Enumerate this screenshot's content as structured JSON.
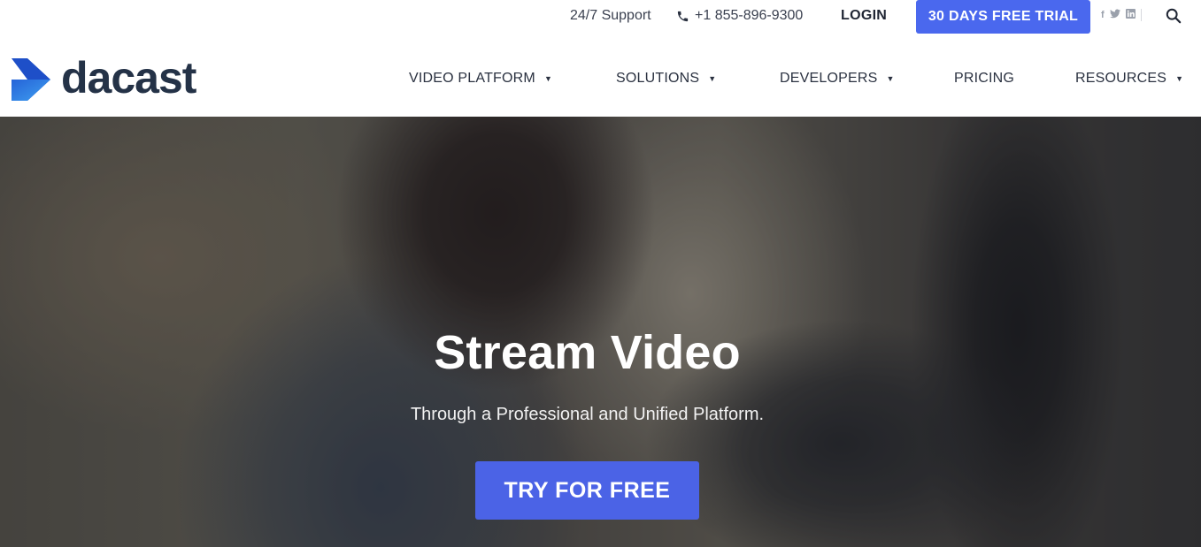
{
  "topbar": {
    "support_label": "24/7 Support",
    "phone": "+1 855-896-9300",
    "login_label": "LOGIN",
    "trial_label": "30 DAYS FREE TRIAL",
    "social": {
      "facebook": "f",
      "twitter": "t",
      "linkedin": "in"
    },
    "search_icon": "search-icon"
  },
  "brand": {
    "name": "dacast",
    "accent": "#3b7de8"
  },
  "nav": {
    "items": [
      {
        "label": "VIDEO PLATFORM",
        "has_dropdown": true
      },
      {
        "label": "SOLUTIONS",
        "has_dropdown": true
      },
      {
        "label": "DEVELOPERS",
        "has_dropdown": true
      },
      {
        "label": "PRICING",
        "has_dropdown": false
      },
      {
        "label": "RESOURCES",
        "has_dropdown": true
      }
    ],
    "caret": "▼"
  },
  "hero": {
    "title": "Stream Video",
    "subtitle": "Through a Professional and Unified Platform.",
    "cta_label": "TRY FOR FREE"
  },
  "colors": {
    "button": "#4a68ee",
    "text_dark": "#243247"
  }
}
